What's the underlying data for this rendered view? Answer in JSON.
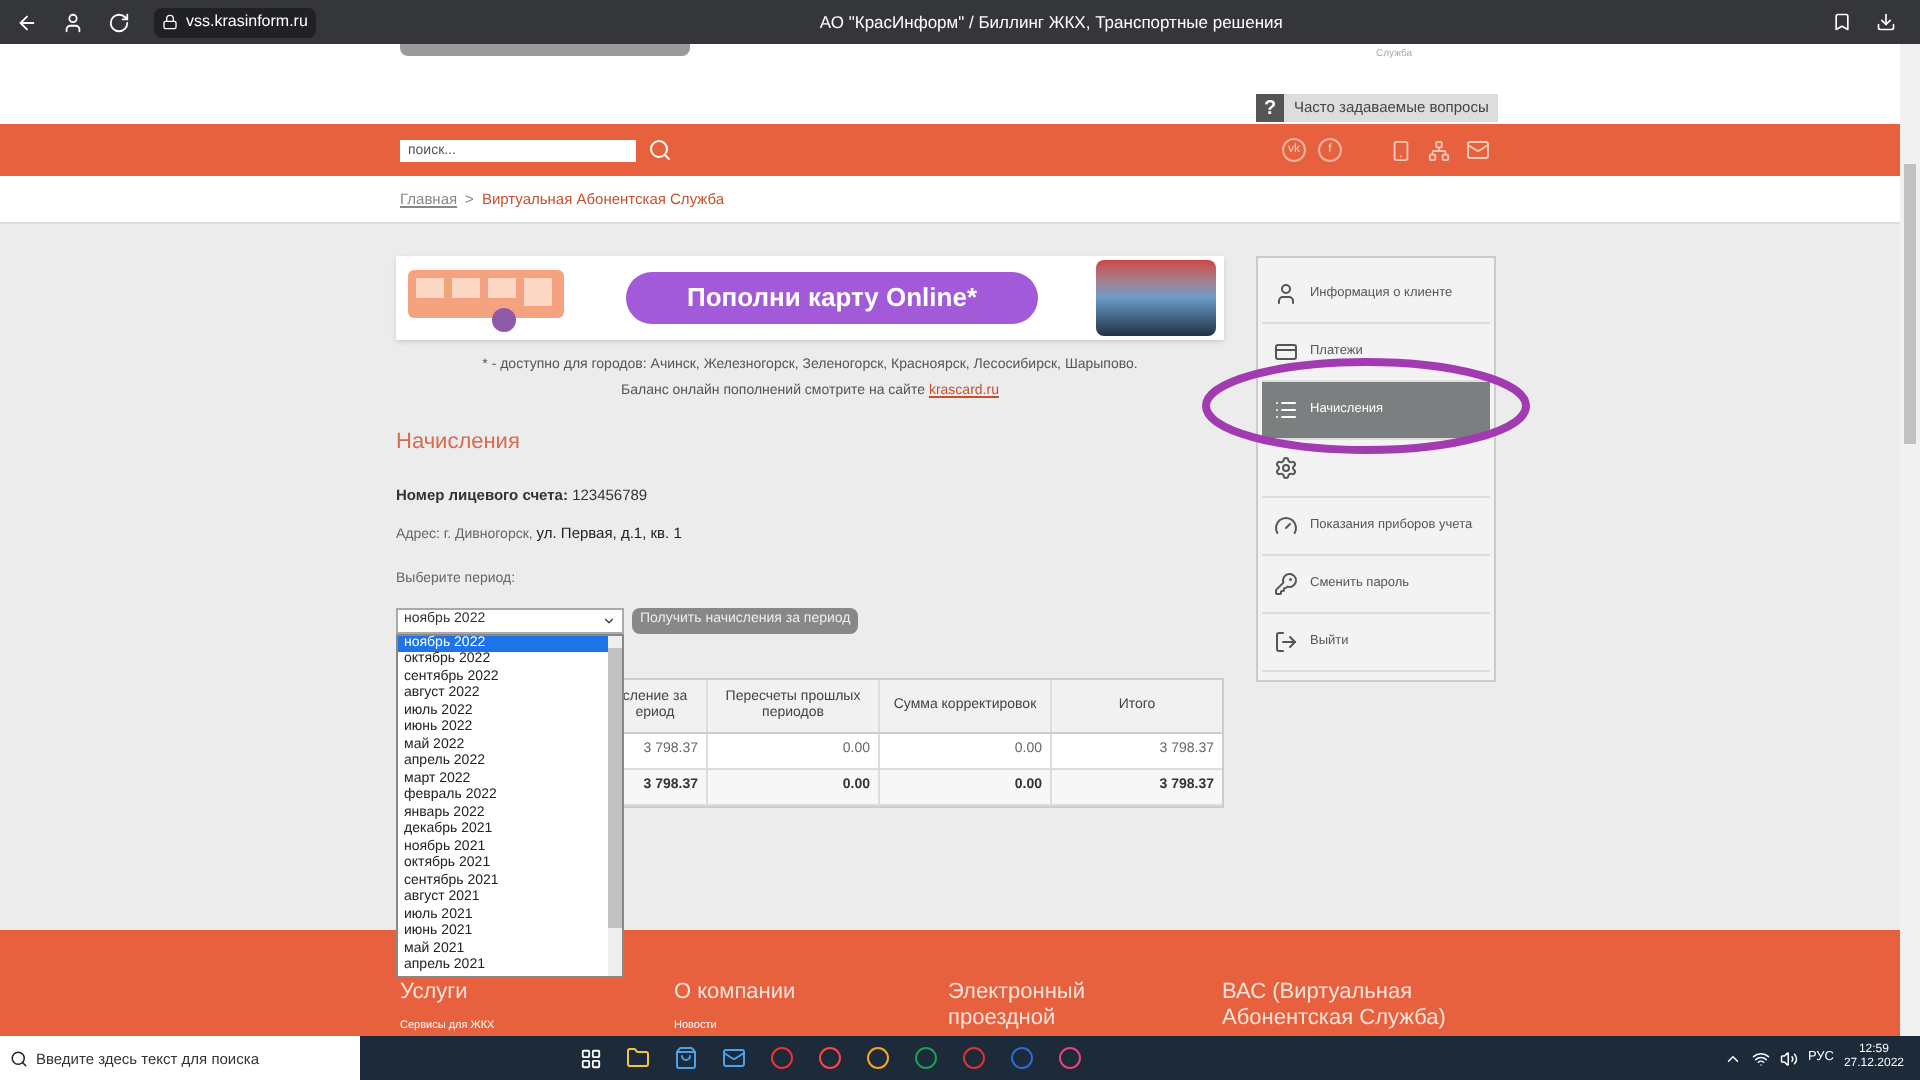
{
  "browser": {
    "url": "vss.krasinform.ru",
    "title": "АО \"КрасИнформ\" / Биллинг ЖКХ, Транспортные решения"
  },
  "header": {
    "logo_caption": "Служба",
    "faq_icon": "?",
    "faq": "Часто задаваемые вопросы"
  },
  "nav": {
    "search_placeholder": "поиск...",
    "social": [
      "vk",
      "f"
    ]
  },
  "breadcrumb": {
    "home": "Главная",
    "separator": ">",
    "current": "Виртуальная Абонентская Служба"
  },
  "banner": {
    "button": "Пополни карту Online*",
    "note": "* - доступно для городов: Ачинск, Железногорск, Зеленогорск, Красноярск, Лесосибирск, Шарыпово.",
    "balance": "Баланс онлайн пополнений смотрите на сайте",
    "link": "krascard.ru"
  },
  "heading": "Начисления",
  "account": {
    "label": "Номер лицевого счета:",
    "value": "123456789"
  },
  "address": {
    "label": "Адрес: г. Дивногорск,",
    "value": "ул. Первая, д.1, кв. 1"
  },
  "period": {
    "label": "Выберите период:",
    "value": "ноябрь 2022",
    "button": "Получить начисления за период",
    "options": [
      {
        "label": "ноябрь 2022",
        "selected": true
      },
      {
        "label": "октябрь 2022",
        "selected": false
      },
      {
        "label": "сентябрь 2022",
        "selected": false
      },
      {
        "label": "август 2022",
        "selected": false
      },
      {
        "label": "июль 2022",
        "selected": false
      },
      {
        "label": "июнь 2022",
        "selected": false
      },
      {
        "label": "май 2022",
        "selected": false
      },
      {
        "label": "апрель 2022",
        "selected": false
      },
      {
        "label": "март 2022",
        "selected": false
      },
      {
        "label": "февраль 2022",
        "selected": false
      },
      {
        "label": "январь 2022",
        "selected": false
      },
      {
        "label": "декабрь 2021",
        "selected": false
      },
      {
        "label": "ноябрь 2021",
        "selected": false
      },
      {
        "label": "октябрь 2021",
        "selected": false
      },
      {
        "label": "сентябрь 2021",
        "selected": false
      },
      {
        "label": "август 2021",
        "selected": false
      },
      {
        "label": "июль 2021",
        "selected": false
      },
      {
        "label": "июнь 2021",
        "selected": false
      },
      {
        "label": "май 2021",
        "selected": false
      },
      {
        "label": "апрель 2021",
        "selected": false
      }
    ]
  },
  "table": {
    "columns": [
      "сление за ериод",
      "Пересчеты прошлых периодов",
      "Сумма корректировок",
      "Итого"
    ],
    "rows": [
      {
        "kind": "data",
        "cells": [
          "3 798.37",
          "0.00",
          "0.00",
          "3 798.37"
        ]
      },
      {
        "kind": "total",
        "cells": [
          "3 798.37",
          "0.00",
          "0.00",
          "3 798.37"
        ]
      }
    ]
  },
  "menu": [
    {
      "label": "Информация о клиенте",
      "selected": false
    },
    {
      "label": "Платежи",
      "selected": false
    },
    {
      "label": "Начисления",
      "selected": true
    },
    {
      "selected": false
    },
    {
      "label": "Показания приборов учета",
      "selected": false
    },
    {
      "label": "Сменить пароль",
      "selected": false
    },
    {
      "label": "Выйти",
      "selected": false
    }
  ],
  "footer": [
    {
      "title": "Услуги",
      "link": "Сервисы для ЖКХ"
    },
    {
      "title": "О компании",
      "link": "Новости"
    },
    {
      "title": "Электронный проездной"
    },
    {
      "title": "ВАС (Виртуальная Абонентская Служба)"
    }
  ],
  "taskbar": {
    "search_placeholder": "Введите здесь текст для поиска",
    "language": "РУС",
    "time": "12:59",
    "date": "27.12.2022"
  }
}
